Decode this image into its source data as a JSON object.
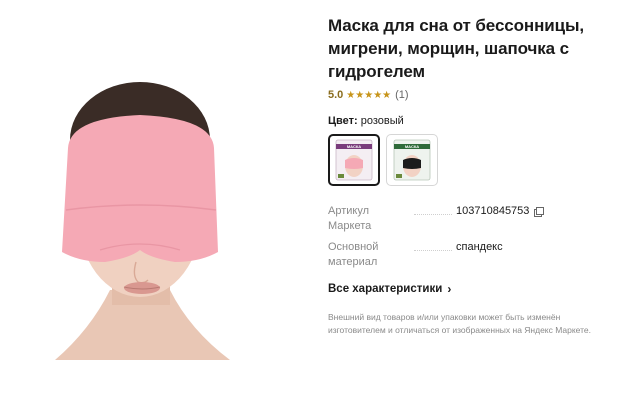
{
  "product": {
    "title": "Маска для сна от бессонницы, мигрени, морщин, шапочка с гидрогелем",
    "rating": "5.0",
    "stars": "★★★★★",
    "reviews": "(1)"
  },
  "color": {
    "label": "Цвет:",
    "value": "розовый",
    "variants": [
      {
        "name": "pink",
        "pack_text": "МАСКА",
        "selected": true
      },
      {
        "name": "black",
        "pack_text": "МАСКА",
        "selected": false
      }
    ]
  },
  "specs": [
    {
      "name": "Артикул Маркета",
      "value": "103710845753",
      "copy_icon": "copy-icon"
    },
    {
      "name": "Основной материал",
      "value": "спандекс"
    }
  ],
  "all_specs_link": "Все характеристики",
  "disclaimer": "Внешний вид товаров и/или упаковки может быть изменён изготовителем и отличаться от изображенных на Яндекс Маркете.",
  "colors": {
    "mask_pink": "#f5a9b5",
    "star": "#c79419",
    "rating": "#8a6d1e",
    "black_mask": "#1c1c1c"
  }
}
